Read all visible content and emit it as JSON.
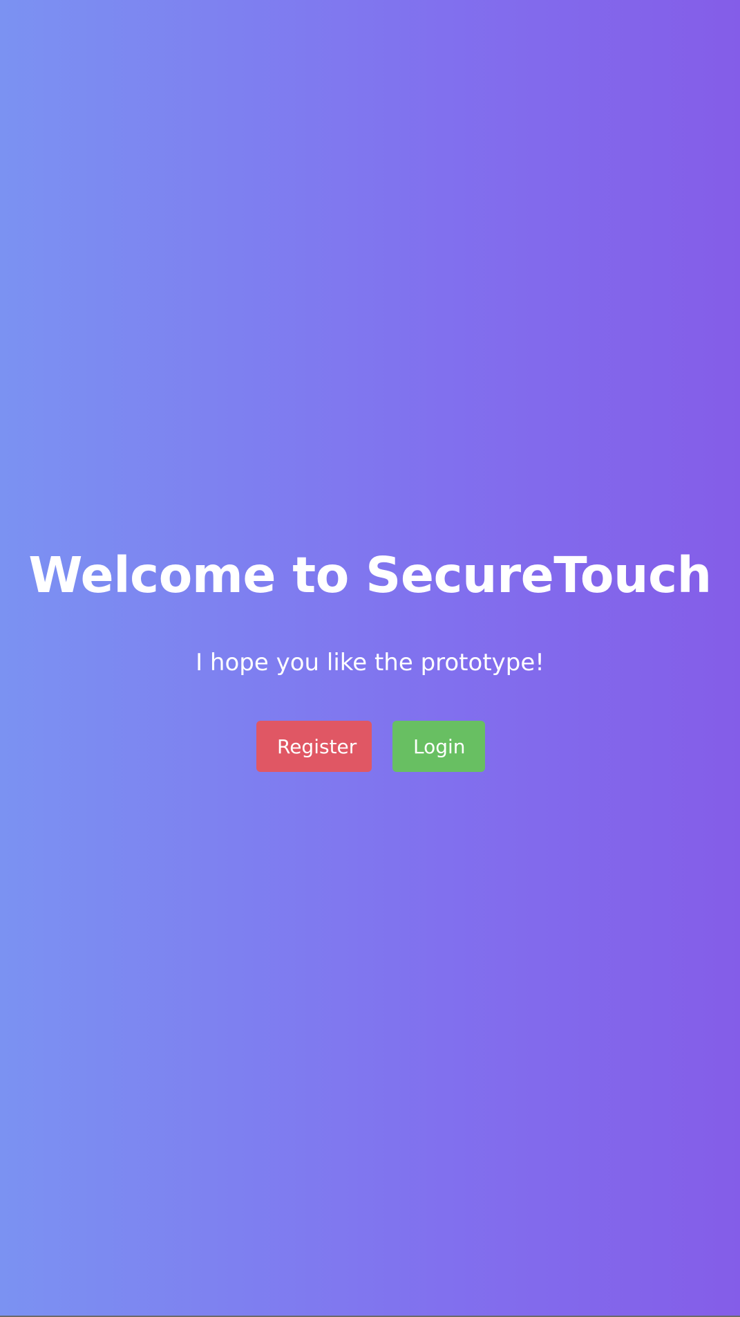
{
  "hero": {
    "title": "Welcome to SecureTouch",
    "subtitle": "I hope you like the prototype!"
  },
  "actions": {
    "register_label": "Register",
    "login_label": "Login"
  },
  "colors": {
    "gradient_start": "#7b92f2",
    "gradient_end": "#845de8",
    "register_button": "#e05764",
    "login_button": "#68bf62",
    "text": "#ffffff"
  }
}
